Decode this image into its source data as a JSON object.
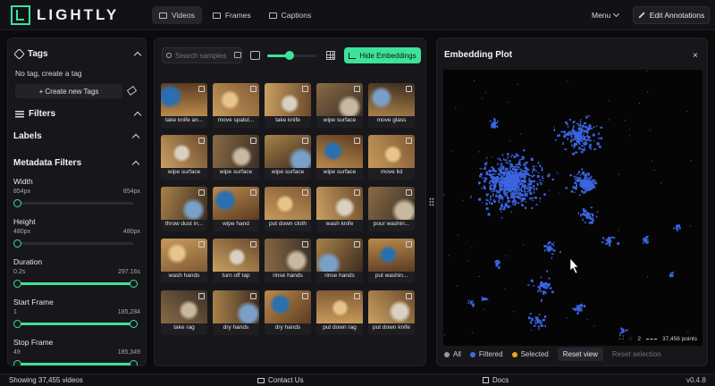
{
  "header": {
    "logo_text": "LIGHTLY",
    "tabs": [
      {
        "label": "Videos",
        "icon": "video-icon",
        "active": true
      },
      {
        "label": "Frames",
        "icon": "frames-icon",
        "active": false
      },
      {
        "label": "Captions",
        "icon": "captions-icon",
        "active": false
      }
    ],
    "menu_label": "Menu",
    "edit_label": "Edit Annotations"
  },
  "sidebar": {
    "tags_title": "Tags",
    "no_tag_text": "No tag, create a tag",
    "new_tag_label": "+ Create new Tags",
    "filters_title": "Filters",
    "labels_title": "Labels",
    "metadata_title": "Metadata Filters",
    "filters": [
      {
        "label": "Width",
        "min": "854px",
        "max": "854px",
        "low": 0.0,
        "high": 0.0
      },
      {
        "label": "Height",
        "min": "480px",
        "max": "480px",
        "low": 0.0,
        "high": 0.0
      },
      {
        "label": "Duration",
        "min": "0.2s",
        "max": "297.16s",
        "low": 0.0,
        "high": 1.0
      },
      {
        "label": "Start Frame",
        "min": "1",
        "max": "185,284",
        "low": 0.0,
        "high": 1.0
      },
      {
        "label": "Stop Frame",
        "min": "49",
        "max": "185,349",
        "low": 0.0,
        "high": 1.0
      }
    ]
  },
  "grid": {
    "search_placeholder": "Search samples by",
    "zoom_level": 0.45,
    "hide_embeddings_label": "Hide Embeddings",
    "samples": [
      "take knife an...",
      "move spatul...",
      "take knife",
      "wipe surface",
      "move glass",
      "wipe surface",
      "wipe surface",
      "wipe surface",
      "wipe surface",
      "move lid",
      "throw dust in...",
      "wipe hand",
      "put down cloth",
      "wash knife",
      "pour washin...",
      "wash hands",
      "turn off tap",
      "rinse hands",
      "rinse hands",
      "put washin...",
      "take rag",
      "dry hands",
      "dry hands",
      "put down rag",
      "put down knife"
    ]
  },
  "embedding": {
    "title": "Embedding Plot",
    "close_label": "×",
    "scale_label": "2",
    "points_label": "37,456 points",
    "legend": [
      {
        "label": "All",
        "color": "#9a9a9a"
      },
      {
        "label": "Filtered",
        "color": "#3f6fe0"
      },
      {
        "label": "Selected",
        "color": "#f0a020"
      }
    ],
    "reset_view_label": "Reset view",
    "reset_selection_label": "Reset selection",
    "point_color": "#3b64e0"
  },
  "status": {
    "count_text": "Showing 37,455 videos",
    "contact_label": "Contact Us",
    "docs_label": "Docs",
    "version": "v0.4.8"
  },
  "colors": {
    "accent": "#3ee29a",
    "background": "#0b0b0d",
    "panel": "#17171b"
  }
}
